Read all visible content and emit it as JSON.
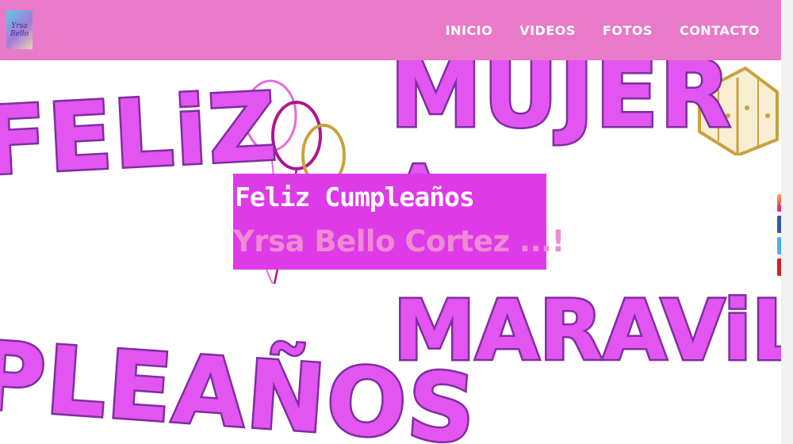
{
  "logo": {
    "line1": "Yrsa",
    "line2": "Bello"
  },
  "nav": {
    "items": [
      "INICIO",
      "VIDEOS",
      "FOTOS",
      "CONTACTO"
    ]
  },
  "hero": {
    "words": [
      "FELiZ",
      "MUJER",
      "MARAViLLA",
      "PLEAÑOS"
    ],
    "title": "Feliz Cumpleaños",
    "subtitle": "Yrsa Bello Cortez ...!"
  },
  "social": {
    "icons": [
      "instagram-icon",
      "facebook-icon",
      "twitter-icon",
      "youtube-icon"
    ]
  },
  "colors": {
    "navbar": "#e97ac9",
    "overlay": "#de3ae8",
    "bubble_fill": "#e255f1",
    "bubble_outline": "#7e2ea0",
    "subtitle": "#ef8ad4",
    "balloon_gold": "#c9a23c"
  }
}
